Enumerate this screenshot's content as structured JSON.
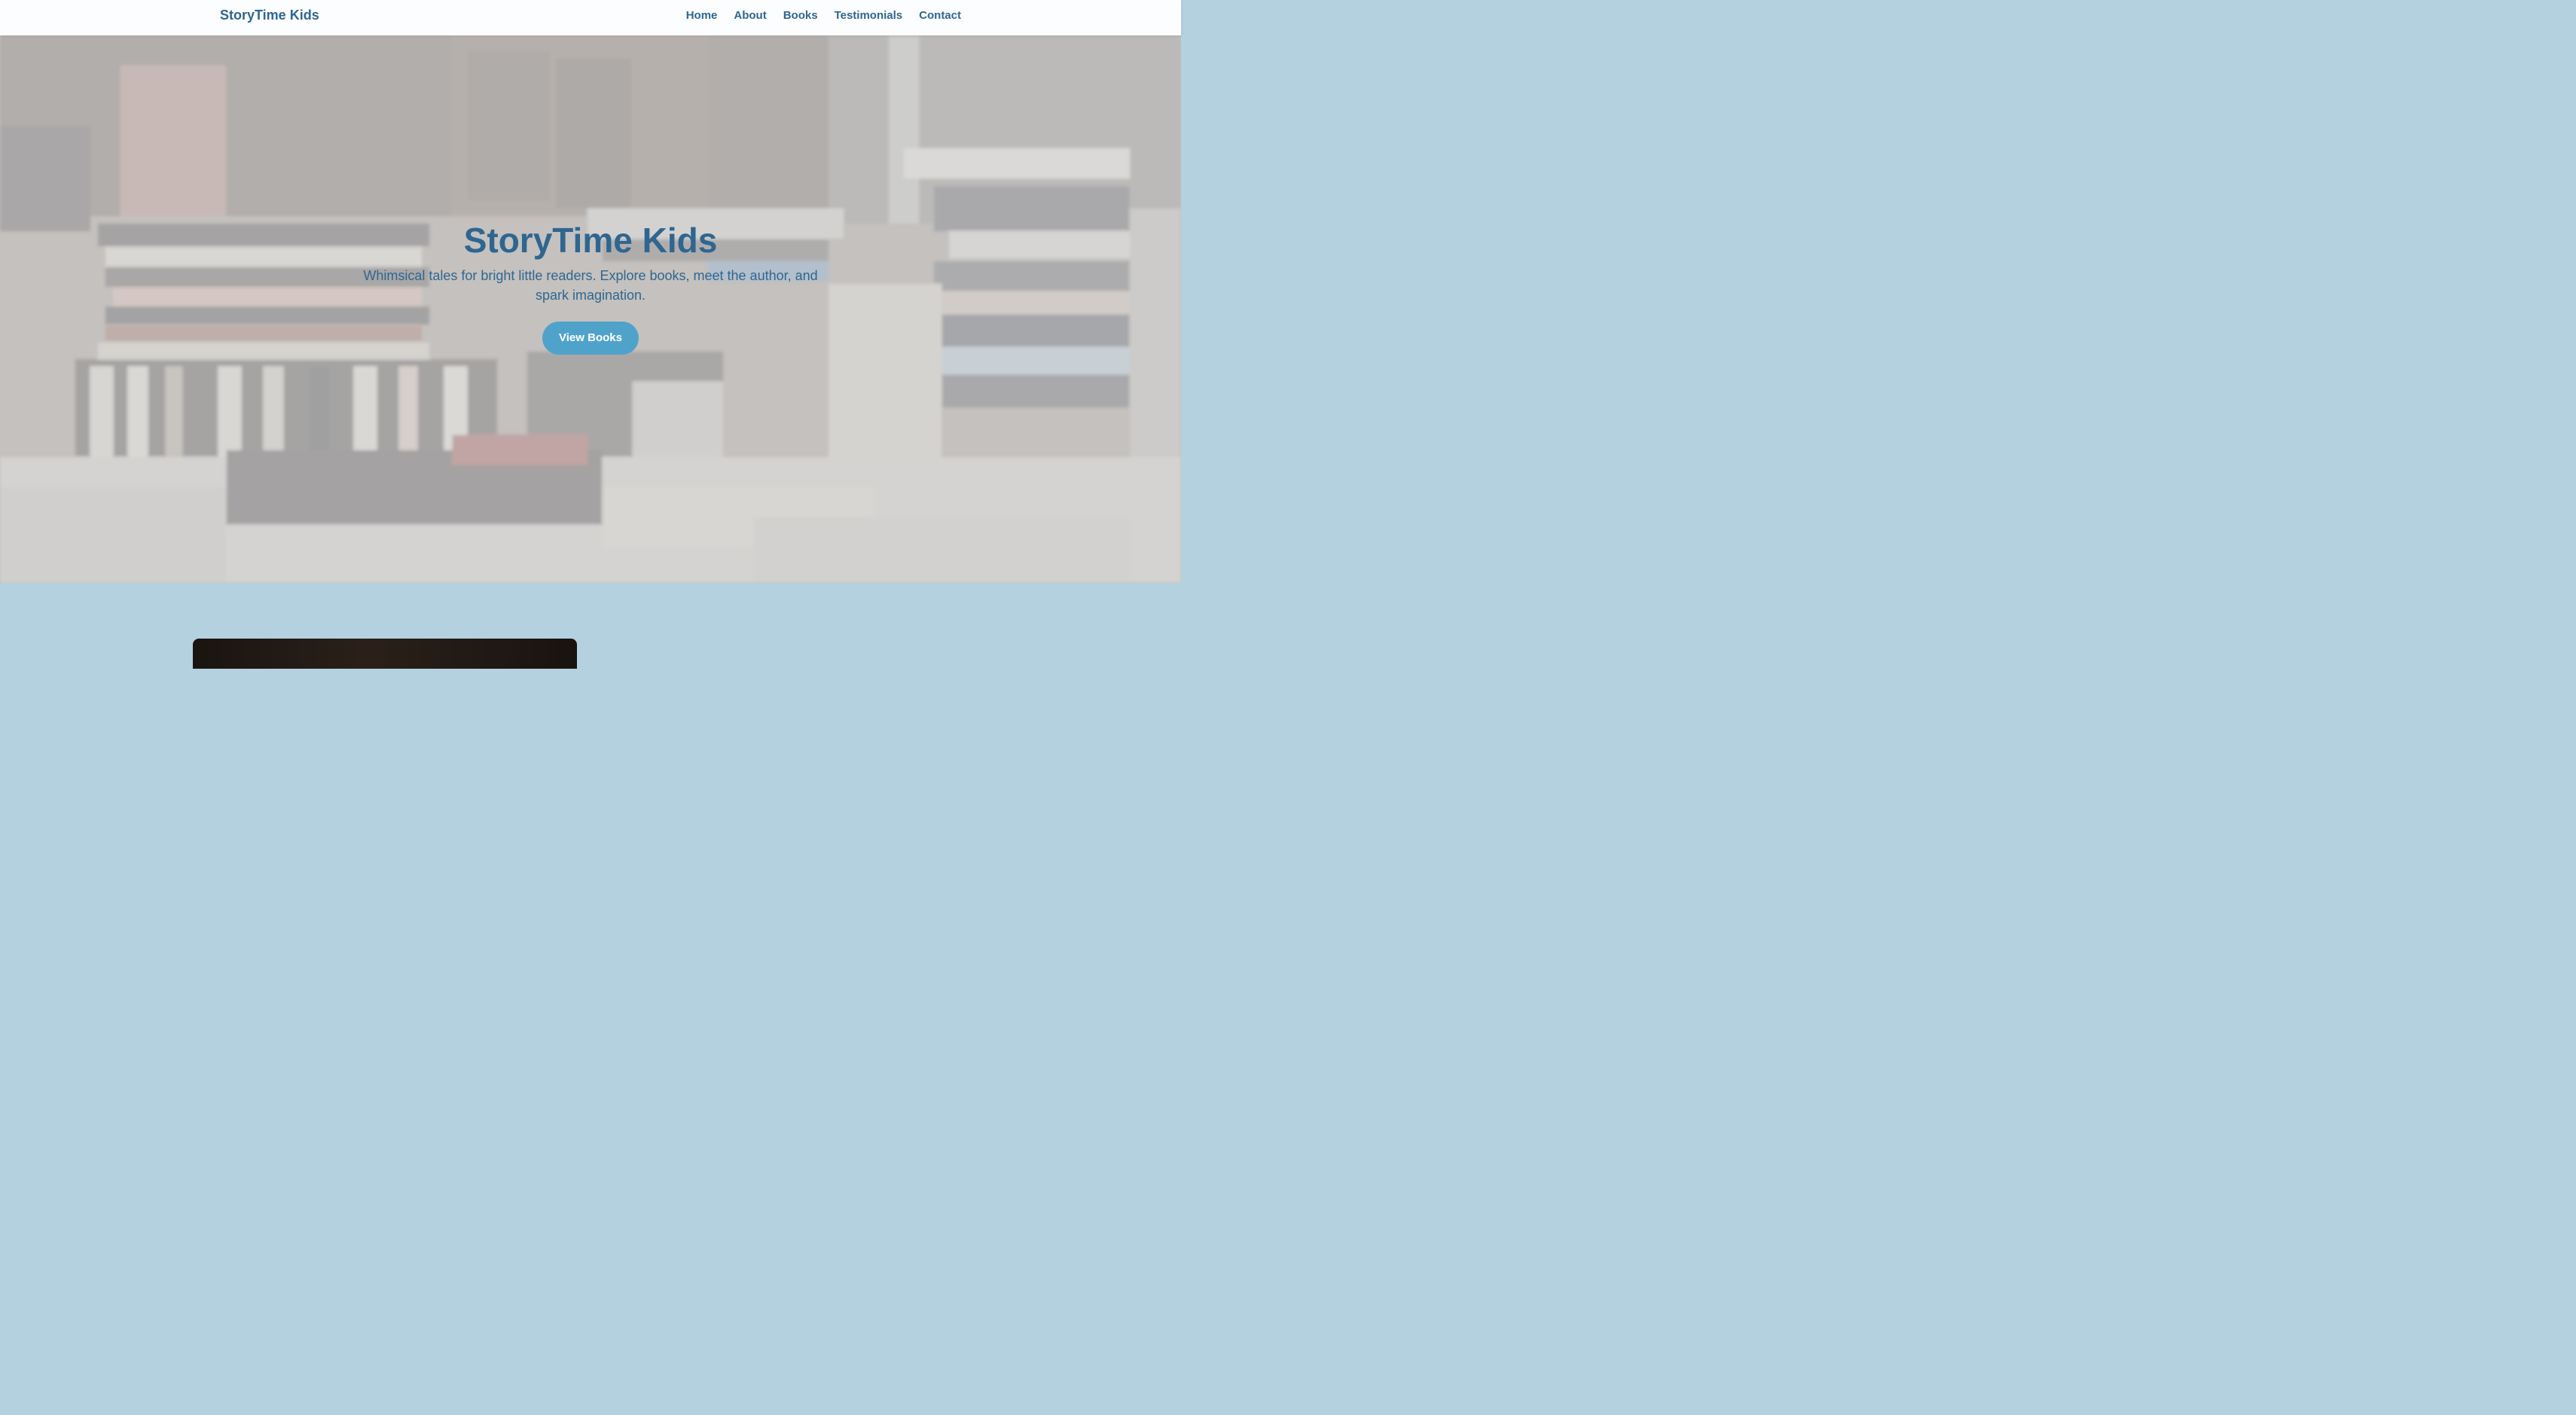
{
  "nav": {
    "brand": "StoryTime Kids",
    "links": [
      "Home",
      "About",
      "Books",
      "Testimonials",
      "Contact"
    ]
  },
  "hero": {
    "title": "StoryTime Kids",
    "subtitle": "Whimsical tales for bright little readers. Explore books, meet the author, and spark imagination.",
    "cta_label": "View Books"
  },
  "colors": {
    "accent": "#2f6690",
    "button": "#4fa3cb",
    "section_bg": "#b4d1e0"
  }
}
